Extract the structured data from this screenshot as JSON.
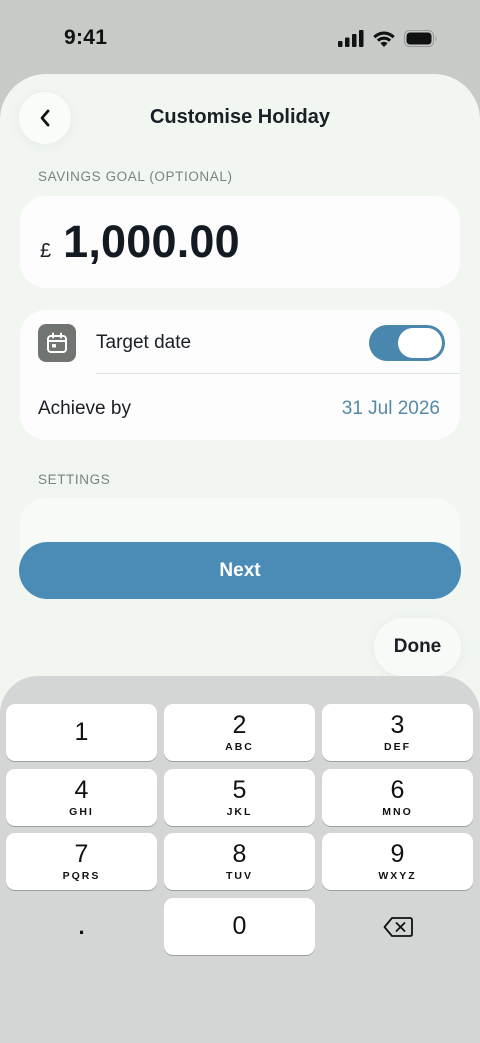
{
  "status_bar": {
    "time": "9:41"
  },
  "header": {
    "title": "Customise Holiday"
  },
  "savings_goal": {
    "label": "SAVINGS GOAL (OPTIONAL)",
    "currency_symbol": "£",
    "amount": "1,000.00"
  },
  "target_date": {
    "label": "Target date",
    "toggle_on": true,
    "achieve_label": "Achieve by",
    "achieve_date": "31 Jul 2026"
  },
  "settings": {
    "label": "SETTINGS"
  },
  "next_button": {
    "label": "Next"
  },
  "done_button": {
    "label": "Done"
  },
  "colors": {
    "accent": "#4a8cb6",
    "date_text": "#5589a7",
    "sheet_bg": "#f1f6f1"
  },
  "keypad": {
    "keys": [
      {
        "number": "1",
        "letters": ""
      },
      {
        "number": "2",
        "letters": "ABC"
      },
      {
        "number": "3",
        "letters": "DEF"
      },
      {
        "number": "4",
        "letters": "GHI"
      },
      {
        "number": "5",
        "letters": "JKL"
      },
      {
        "number": "6",
        "letters": "MNO"
      },
      {
        "number": "7",
        "letters": "PQRS"
      },
      {
        "number": "8",
        "letters": "TUV"
      },
      {
        "number": "9",
        "letters": "WXYZ"
      },
      {
        "number": "0",
        "letters": ""
      }
    ],
    "decimal": ".",
    "delete_icon": "backspace-icon"
  }
}
